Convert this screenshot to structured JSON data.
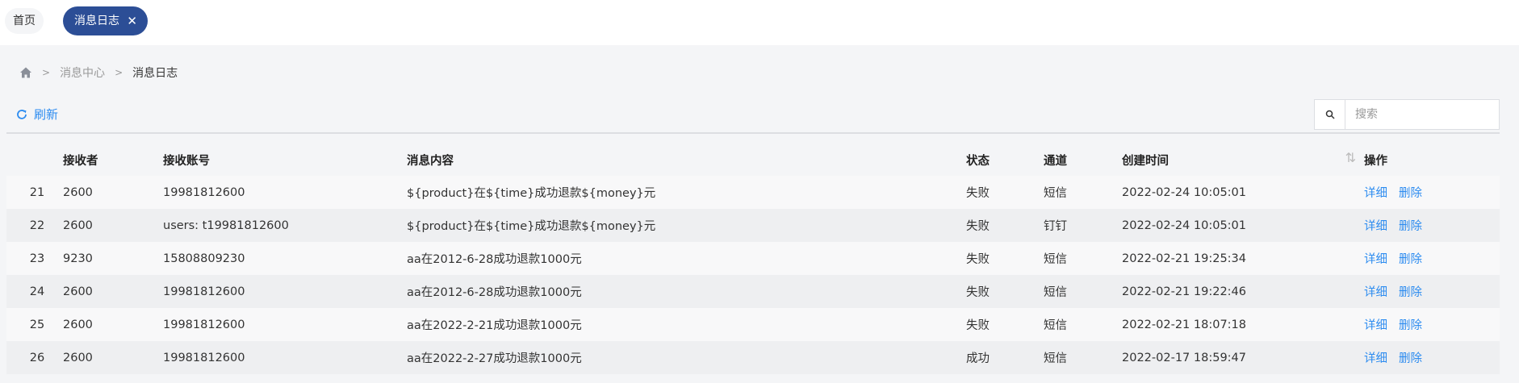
{
  "tabs": {
    "home_label": "首页",
    "active_label": "消息日志",
    "close_glyph": "✕"
  },
  "breadcrumb": {
    "home_icon": "home-icon",
    "parent": "消息中心",
    "current": "消息日志"
  },
  "toolbar": {
    "refresh_label": "刷新",
    "refresh_icon": "refresh-icon",
    "search_icon": "search-icon",
    "search_placeholder": "搜索",
    "search_value": ""
  },
  "table": {
    "columns": {
      "index": "",
      "receiver": "接收者",
      "account": "接收账号",
      "content": "消息内容",
      "status": "状态",
      "channel": "通道",
      "created": "创建时间",
      "ops": "操作"
    },
    "sort_glyph": "⇅",
    "op_detail": "详细",
    "op_delete": "删除",
    "rows": [
      {
        "index": "21",
        "receiver": "2600",
        "account": "19981812600",
        "content": "${product}在${time}成功退款${money}元",
        "status": "失败",
        "channel": "短信",
        "created": "2022-02-24 10:05:01"
      },
      {
        "index": "22",
        "receiver": "2600",
        "account": "users: t19981812600",
        "content": "${product}在${time}成功退款${money}元",
        "status": "失败",
        "channel": "钉钉",
        "created": "2022-02-24 10:05:01"
      },
      {
        "index": "23",
        "receiver": "9230",
        "account": "15808809230",
        "content": "aa在2012-6-28成功退款1000元",
        "status": "失败",
        "channel": "短信",
        "created": "2022-02-21 19:25:34"
      },
      {
        "index": "24",
        "receiver": "2600",
        "account": "19981812600",
        "content": "aa在2012-6-28成功退款1000元",
        "status": "失败",
        "channel": "短信",
        "created": "2022-02-21 19:22:46"
      },
      {
        "index": "25",
        "receiver": "2600",
        "account": "19981812600",
        "content": "aa在2022-2-21成功退款1000元",
        "status": "失败",
        "channel": "短信",
        "created": "2022-02-21 18:07:18"
      },
      {
        "index": "26",
        "receiver": "2600",
        "account": "19981812600",
        "content": "aa在2022-2-27成功退款1000元",
        "status": "成功",
        "channel": "短信",
        "created": "2022-02-17 18:59:47"
      }
    ]
  },
  "colors": {
    "accent": "#2c4e96",
    "link": "#2d8cf0"
  }
}
